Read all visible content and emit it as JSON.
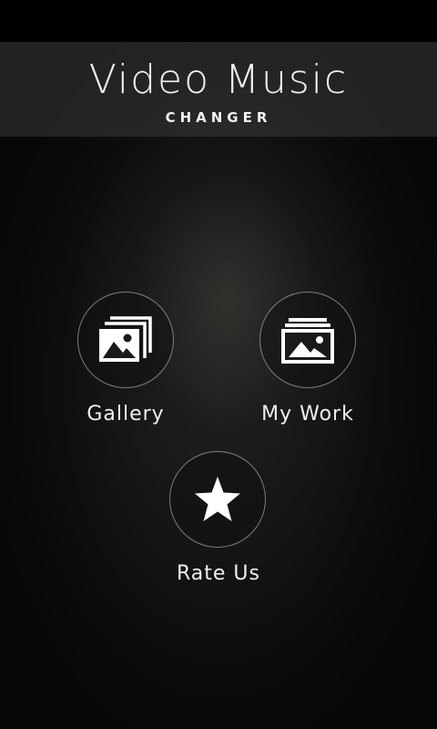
{
  "app": {
    "title": "Video Music",
    "subtitle": "CHANGER"
  },
  "menu": {
    "gallery": {
      "label": "Gallery",
      "icon": "gallery-stack-icon"
    },
    "my_work": {
      "label": "My Work",
      "icon": "image-folder-icon"
    },
    "rate_us": {
      "label": "Rate Us",
      "icon": "star-icon"
    }
  },
  "colors": {
    "text": "#f2f2f2",
    "ring": "#d2d2d2",
    "background": "#0c0c0c"
  }
}
